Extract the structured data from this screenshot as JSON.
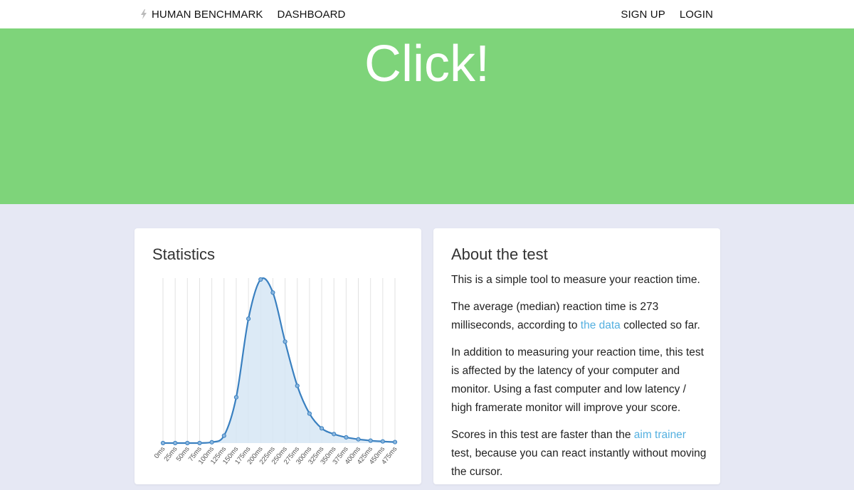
{
  "nav": {
    "brand": "HUMAN BENCHMARK",
    "dashboard": "DASHBOARD",
    "signup": "SIGN UP",
    "login": "LOGIN"
  },
  "hero": {
    "title": "Click!",
    "background": "#7ed47a"
  },
  "stats": {
    "title": "Statistics"
  },
  "about": {
    "title": "About the test",
    "p1": "This is a simple tool to measure your reaction time.",
    "p2_before": "The average (median) reaction time is 273 milliseconds, according to ",
    "p2_link": "the data",
    "p2_after": " collected so far.",
    "p3": "In addition to measuring your reaction time, this test is affected by the latency of your computer and monitor. Using a fast computer and low latency / high framerate monitor will improve your score.",
    "p4_before": "Scores in this test are faster than the ",
    "p4_link": "aim trainer",
    "p4_after": " test, because you can react instantly without moving the cursor."
  },
  "colors": {
    "line": "#3a80c0",
    "fill": "#d6e6f5",
    "link": "#54b0e0"
  },
  "chart_data": {
    "type": "area",
    "categories": [
      "0ms",
      "25ms",
      "50ms",
      "75ms",
      "100ms",
      "125ms",
      "150ms",
      "175ms",
      "200ms",
      "225ms",
      "250ms",
      "275ms",
      "300ms",
      "325ms",
      "350ms",
      "375ms",
      "400ms",
      "425ms",
      "450ms",
      "475ms"
    ],
    "values": [
      0.0,
      0.0,
      0.0,
      0.0,
      0.5,
      4.5,
      28,
      76,
      100,
      92,
      62,
      35,
      18,
      9,
      5.5,
      3.5,
      2.3,
      1.5,
      1.0,
      0.6
    ],
    "ylim": [
      0,
      100
    ],
    "grid": "vertical",
    "title": "",
    "xlabel": "",
    "ylabel": ""
  }
}
